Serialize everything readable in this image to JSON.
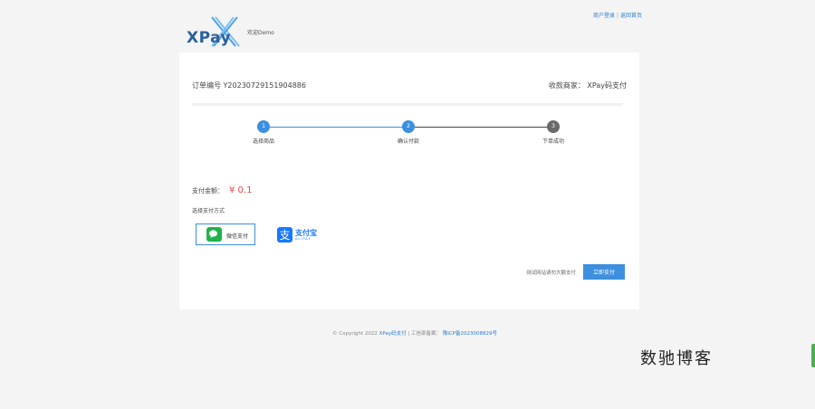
{
  "header": {
    "logo_text": "XPay",
    "welcome": "欢迎Demo",
    "links": [
      "商户登录",
      "返回首页"
    ]
  },
  "order": {
    "label": "订单编号",
    "number": "Y20230729151904886",
    "merchant_label": "收款商家",
    "merchant_name": "XPay码支付"
  },
  "steps": [
    {
      "num": "1",
      "label": "选择商品",
      "state": "active"
    },
    {
      "num": "2",
      "label": "确认付款",
      "state": "active"
    },
    {
      "num": "3",
      "label": "下单成功",
      "state": "inactive"
    }
  ],
  "payment": {
    "amount_label": "支付金额：",
    "amount": "¥ 0.1",
    "method_title": "选择支付方式",
    "methods": [
      {
        "name": "wechat",
        "label": "微信支付",
        "icon": "wechat-pay-icon",
        "selected": true
      },
      {
        "name": "alipay",
        "label": "支付宝",
        "sub": "ALIPAY",
        "icon": "alipay-icon",
        "selected": false
      }
    ],
    "hint": "测试网站请勿大额支付",
    "submit": "立即支付"
  },
  "footer": {
    "copyright": "© Copyright 2022",
    "brand": "XPay码支付",
    "icp_label": " | 工信部备案：",
    "icp": "豫ICP备2023008829号"
  },
  "watermark": "数驰博客",
  "colors": {
    "accent": "#3d8fe0",
    "price": "#e84b4b",
    "wechat": "#21b24c",
    "alipay": "#1677ff",
    "logo": "#2a5f9e"
  }
}
